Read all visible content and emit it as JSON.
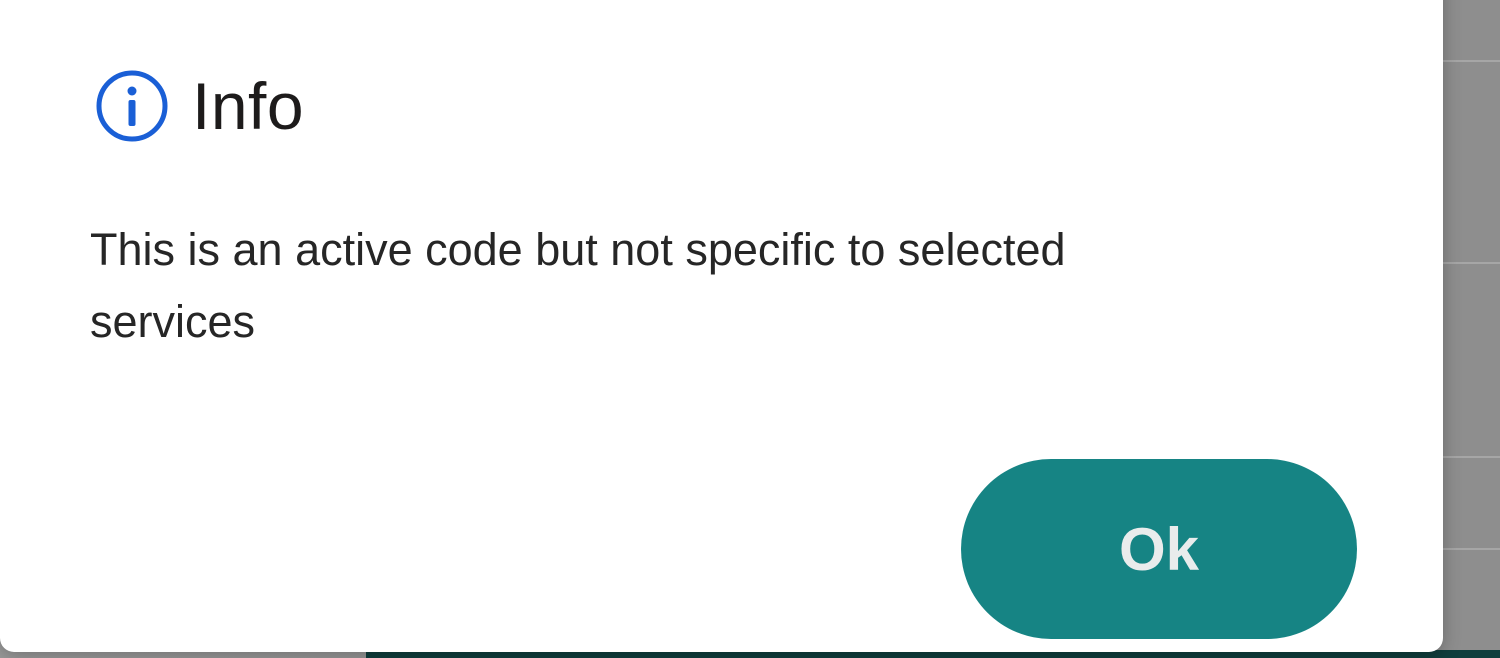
{
  "dialog": {
    "title": "Info",
    "icon": "info-icon",
    "message": "This is an active code but not specific to selected services",
    "ok_label": "Ok"
  },
  "colors": {
    "accent": "#168484",
    "icon": "#1a5fd6",
    "title_text": "#1d1b1b",
    "message_text": "#262626"
  }
}
